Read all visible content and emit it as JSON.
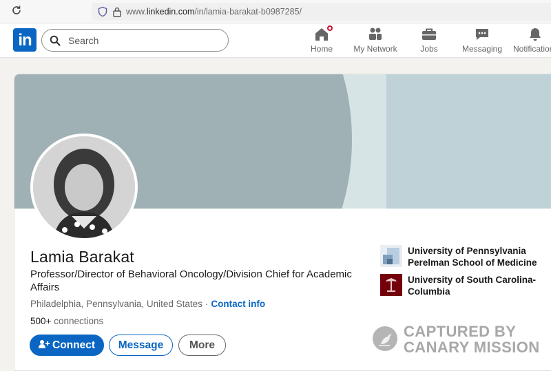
{
  "browser": {
    "url_prefix": "www.",
    "url_domain": "linkedin.com",
    "url_path": "/in/lamia-barakat-b0987285/"
  },
  "nav": {
    "logo": "in",
    "search_placeholder": "Search",
    "items": [
      {
        "label": "Home",
        "icon": "home-icon"
      },
      {
        "label": "My Network",
        "icon": "network-icon"
      },
      {
        "label": "Jobs",
        "icon": "briefcase-icon"
      },
      {
        "label": "Messaging",
        "icon": "messaging-icon"
      },
      {
        "label": "Notifications",
        "icon": "bell-icon"
      }
    ]
  },
  "profile": {
    "name": "Lamia Barakat",
    "headline": "Professor/Director of Behavioral Oncology/Division Chief for Academic Affairs",
    "location": "Philadelphia, Pennsylvania, United States",
    "separator": "·",
    "contact_info": "Contact info",
    "connections_count": "500+",
    "connections_label": "connections",
    "buttons": {
      "connect": "Connect",
      "message": "Message",
      "more": "More"
    },
    "organizations": [
      {
        "name": "University of Pennsylvania Perelman School of Medicine",
        "logo_color": "#9db7cf"
      },
      {
        "name": "University of South Carolina-Columbia",
        "logo_color": "#73000a"
      }
    ]
  },
  "watermark": {
    "line1": "CAPTURED BY",
    "line2": "CANARY MISSION"
  },
  "colors": {
    "linkedin_blue": "#0a66c2",
    "banner": "#9fb1b5",
    "notification_red": "#cb112d"
  }
}
